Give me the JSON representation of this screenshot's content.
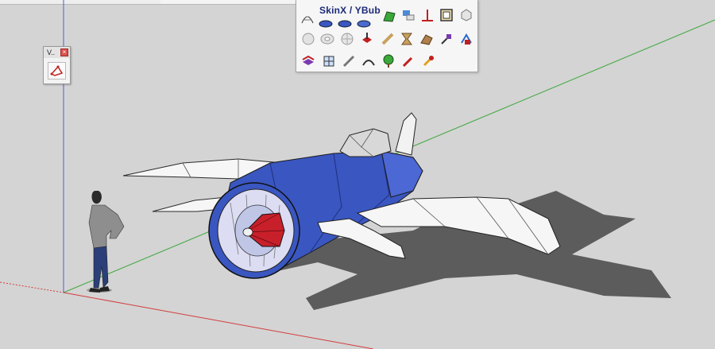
{
  "mini_toolbar": {
    "title": "V..",
    "close_glyph": "×",
    "tool_icon": "polygon-select-icon"
  },
  "plugin_toolbar": {
    "title": "SkinX / YBub",
    "rows": [
      [
        "skin-mesh-icon",
        "skinx-icon",
        "ybub-icon",
        "shell-icon",
        "surface-icon",
        "flip-icon",
        "axis-icon",
        "frame-icon",
        "cube-icon"
      ],
      [
        "sphere-icon",
        "torus-icon",
        "globe-icon",
        "push-pull-icon",
        "bend-icon",
        "hourglass-icon",
        "fold-icon",
        "pin-icon",
        "vertex-icon"
      ],
      [
        "layer-icon",
        "grid-icon",
        "knife-icon",
        "arc-icon",
        "tree-icon",
        "pencil-icon",
        "dropper-icon"
      ]
    ]
  },
  "colors": {
    "ground": "#d4d4d4",
    "axis_green": "#3fa83f",
    "axis_red": "#d43c3c",
    "axis_blue": "#4a5fd8",
    "fuselage_blue": "#3a56c0",
    "wing_white": "#f4f4f4",
    "shadow": "#5a5a5a",
    "nose_red": "#c8202a"
  },
  "scene": {
    "model": "plane-model",
    "figure": "scale-figure"
  }
}
